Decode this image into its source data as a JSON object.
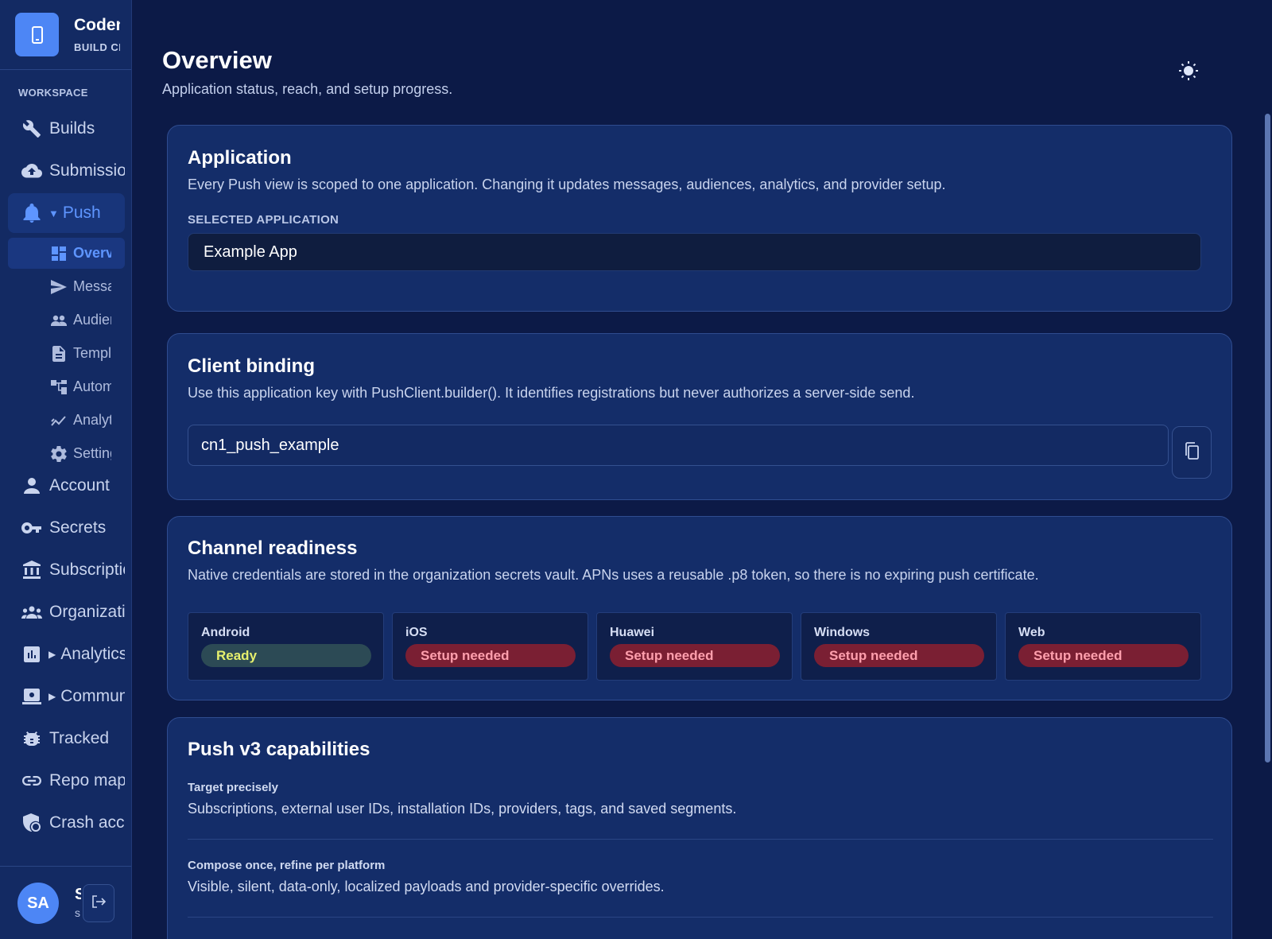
{
  "brand": {
    "name": "Codename One",
    "sub": "BUILD CLOUD"
  },
  "sidebar": {
    "section_label": "WORKSPACE",
    "items": [
      {
        "label": "Builds",
        "icon": "wrench-icon"
      },
      {
        "label": "Submissions",
        "icon": "cloud-upload-icon"
      },
      {
        "label": "Push",
        "icon": "bell-icon",
        "expanded": true
      },
      {
        "label": "Account",
        "icon": "person-icon"
      },
      {
        "label": "Secrets",
        "icon": "key-icon"
      },
      {
        "label": "Subscription",
        "icon": "bank-icon"
      },
      {
        "label": "Organization",
        "icon": "group-icon"
      },
      {
        "label": "Analytics",
        "icon": "chart-icon",
        "collapsed": true
      },
      {
        "label": "Community",
        "icon": "forum-icon",
        "collapsed": true
      },
      {
        "label": "Tracked",
        "icon": "bug-icon"
      },
      {
        "label": "Repo mapping",
        "icon": "link-icon"
      },
      {
        "label": "Crash accounting",
        "icon": "shield-icon"
      }
    ],
    "push_items": [
      {
        "label": "Overview",
        "icon": "dashboard-icon",
        "active": true
      },
      {
        "label": "Messages",
        "icon": "send-icon"
      },
      {
        "label": "Audiences",
        "icon": "people-icon"
      },
      {
        "label": "Templates",
        "icon": "document-icon"
      },
      {
        "label": "Automations",
        "icon": "flow-icon"
      },
      {
        "label": "Analytics",
        "icon": "trend-icon"
      },
      {
        "label": "Settings",
        "icon": "gear-icon"
      }
    ]
  },
  "user": {
    "initials": "SA",
    "name": "S",
    "email": "s"
  },
  "header": {
    "title": "Overview",
    "subtitle": "Application status, reach, and setup progress."
  },
  "application": {
    "title": "Application",
    "description": "Every Push view is scoped to one application. Changing it updates messages, audiences, analytics, and provider setup.",
    "field_label": "SELECTED APPLICATION",
    "selected": "Example App"
  },
  "client_binding": {
    "title": "Client binding",
    "description": "Use this application key with PushClient.builder(). It identifies registrations but never authorizes a server-side send.",
    "key": "cn1_push_example"
  },
  "channels": {
    "title": "Channel readiness",
    "description": "Native credentials are stored in the organization secrets vault. APNs uses a reusable .p8 token, so there is no expiring push certificate.",
    "items": [
      {
        "name": "Android",
        "status": "Ready",
        "state": "ready"
      },
      {
        "name": "iOS",
        "status": "Setup needed",
        "state": "needed"
      },
      {
        "name": "Huawei",
        "status": "Setup needed",
        "state": "needed"
      },
      {
        "name": "Windows",
        "status": "Setup needed",
        "state": "needed"
      },
      {
        "name": "Web",
        "status": "Setup needed",
        "state": "needed"
      }
    ]
  },
  "capabilities": {
    "title": "Push v3 capabilities",
    "items": [
      {
        "title": "Target precisely",
        "text": "Subscriptions, external user IDs, installation IDs, providers, tags, and saved segments."
      },
      {
        "title": "Compose once, refine per platform",
        "text": "Visible, silent, data-only, localized payloads and provider-specific overrides."
      }
    ]
  },
  "colors": {
    "accent": "#5e95ff",
    "brand": "#4d86f5",
    "ready": "#e6f06d",
    "needed": "#ff9fad"
  }
}
